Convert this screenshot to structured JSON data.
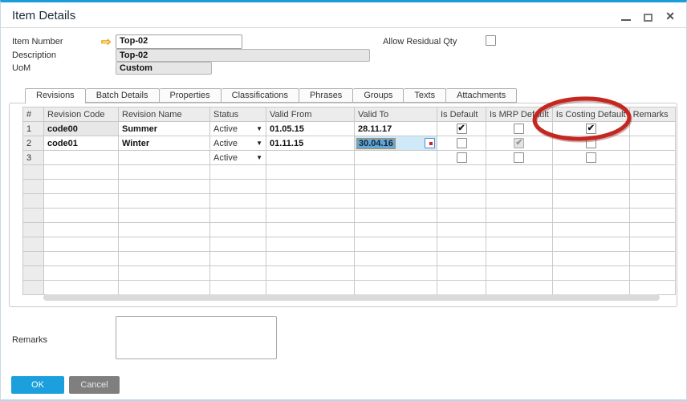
{
  "window": {
    "title": "Item Details"
  },
  "icons": {
    "close": "✕",
    "check": "✔",
    "dropdown": "▼",
    "link_arrow": "⇨"
  },
  "form": {
    "fields": [
      {
        "label": "Item Number",
        "value": "Top-02"
      },
      {
        "label": "Description",
        "value": "Top-02"
      },
      {
        "label": "UoM",
        "value": "Custom"
      }
    ],
    "allow_residual_qty": {
      "label": "Allow Residual Qty",
      "checked": false
    }
  },
  "tabs": [
    {
      "label": "Revisions",
      "active": true
    },
    {
      "label": "Batch Details",
      "active": false
    },
    {
      "label": "Properties",
      "active": false
    },
    {
      "label": "Classifications",
      "active": false
    },
    {
      "label": "Phrases",
      "active": false
    },
    {
      "label": "Groups",
      "active": false
    },
    {
      "label": "Texts",
      "active": false
    },
    {
      "label": "Attachments",
      "active": false
    }
  ],
  "table": {
    "columns": [
      "#",
      "Revision Code",
      "Revision Name",
      "Status",
      "Valid From",
      "Valid To",
      "Is Default",
      "Is MRP Default",
      "Is Costing Default",
      "Remarks"
    ],
    "rows": [
      {
        "num": "1",
        "revision_code": "code00",
        "code_cell_gray": true,
        "revision_name": "Summer",
        "status": "Active",
        "valid_from": "01.05.15",
        "valid_to": "28.11.17",
        "is_default": "checked",
        "is_mrp_default": "unchecked",
        "is_costing_default": "checked",
        "remarks": ""
      },
      {
        "num": "2",
        "revision_code": "code01",
        "code_cell_gray": false,
        "revision_name": "Winter",
        "status": "Active",
        "valid_from": "01.11.15",
        "valid_to": "30.04.16",
        "valid_to_state": "editing",
        "is_default": "unchecked",
        "is_mrp_default": "checked-disabled",
        "is_costing_default": "unchecked",
        "remarks": ""
      },
      {
        "num": "3",
        "revision_code": "",
        "code_cell_gray": false,
        "revision_name": "",
        "status": "Active",
        "valid_from": "",
        "valid_to": "",
        "is_default": "unchecked",
        "is_mrp_default": "unchecked",
        "is_costing_default": "unchecked",
        "remarks": ""
      }
    ],
    "empty_row_count": 9
  },
  "annotation": {
    "shape": "red-ellipse",
    "target": "Is Costing Default",
    "color": "#c4271f"
  },
  "remarks": {
    "label": "Remarks",
    "value": ""
  },
  "footer": {
    "ok_label": "OK",
    "cancel_label": "Cancel"
  }
}
